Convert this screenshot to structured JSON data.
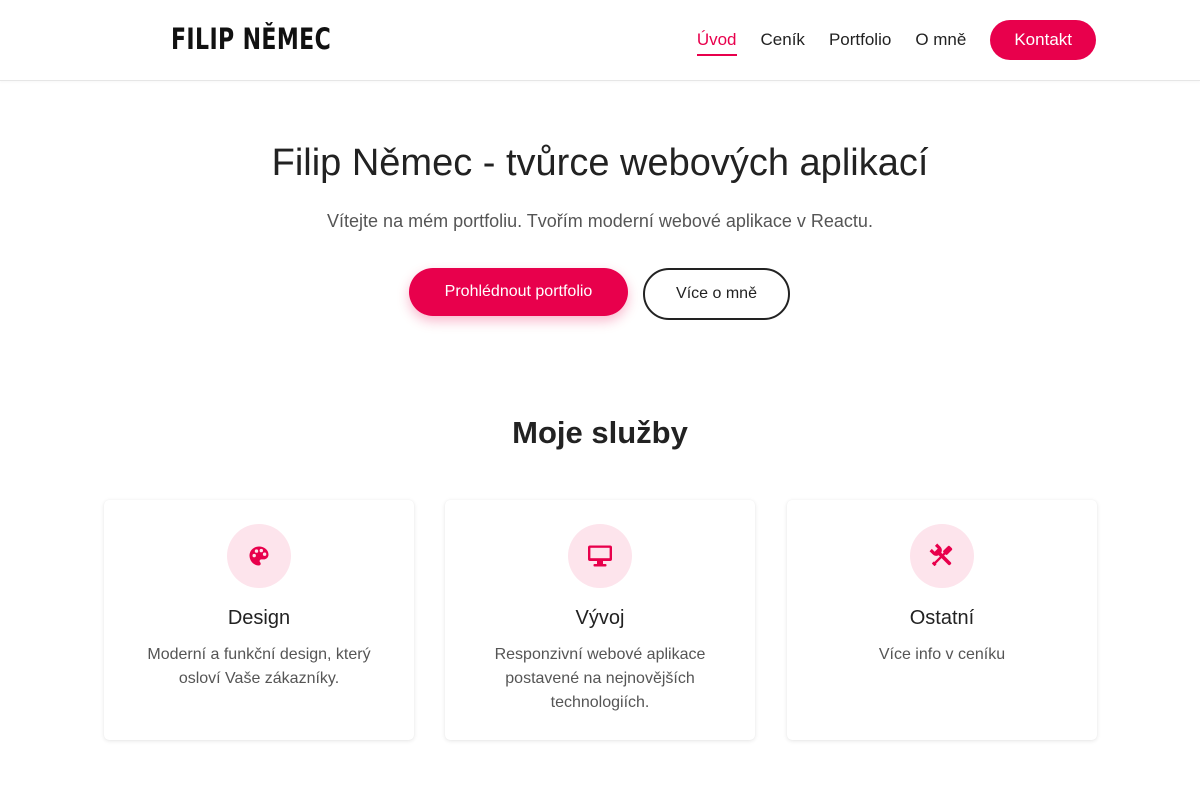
{
  "header": {
    "logo": "FILIP NĚMEC",
    "nav": [
      {
        "label": "Úvod",
        "active": true
      },
      {
        "label": "Ceník",
        "active": false
      },
      {
        "label": "Portfolio",
        "active": false
      },
      {
        "label": "O mně",
        "active": false
      }
    ],
    "cta_label": "Kontakt"
  },
  "hero": {
    "title": "Filip Němec - tvůrce webových aplikací",
    "subtitle": "Vítejte na mém portfoliu. Tvořím moderní webové aplikace v Reactu.",
    "primary_button": "Prohlédnout portfolio",
    "secondary_button": "Více o mně"
  },
  "services": {
    "title": "Moje služby",
    "items": [
      {
        "icon": "palette-icon",
        "title": "Design",
        "text": "Moderní a funkční design, který osloví Vaše zákazníky."
      },
      {
        "icon": "desktop-icon",
        "title": "Vývoj",
        "text": "Responzivní webové aplikace postavené na nejnovějších technologiích."
      },
      {
        "icon": "tools-icon",
        "title": "Ostatní",
        "text": "Více info v ceníku"
      }
    ]
  },
  "colors": {
    "accent": "#e8004c",
    "icon_background": "#fde4ec",
    "text": "#222222",
    "muted_text": "#555555"
  }
}
